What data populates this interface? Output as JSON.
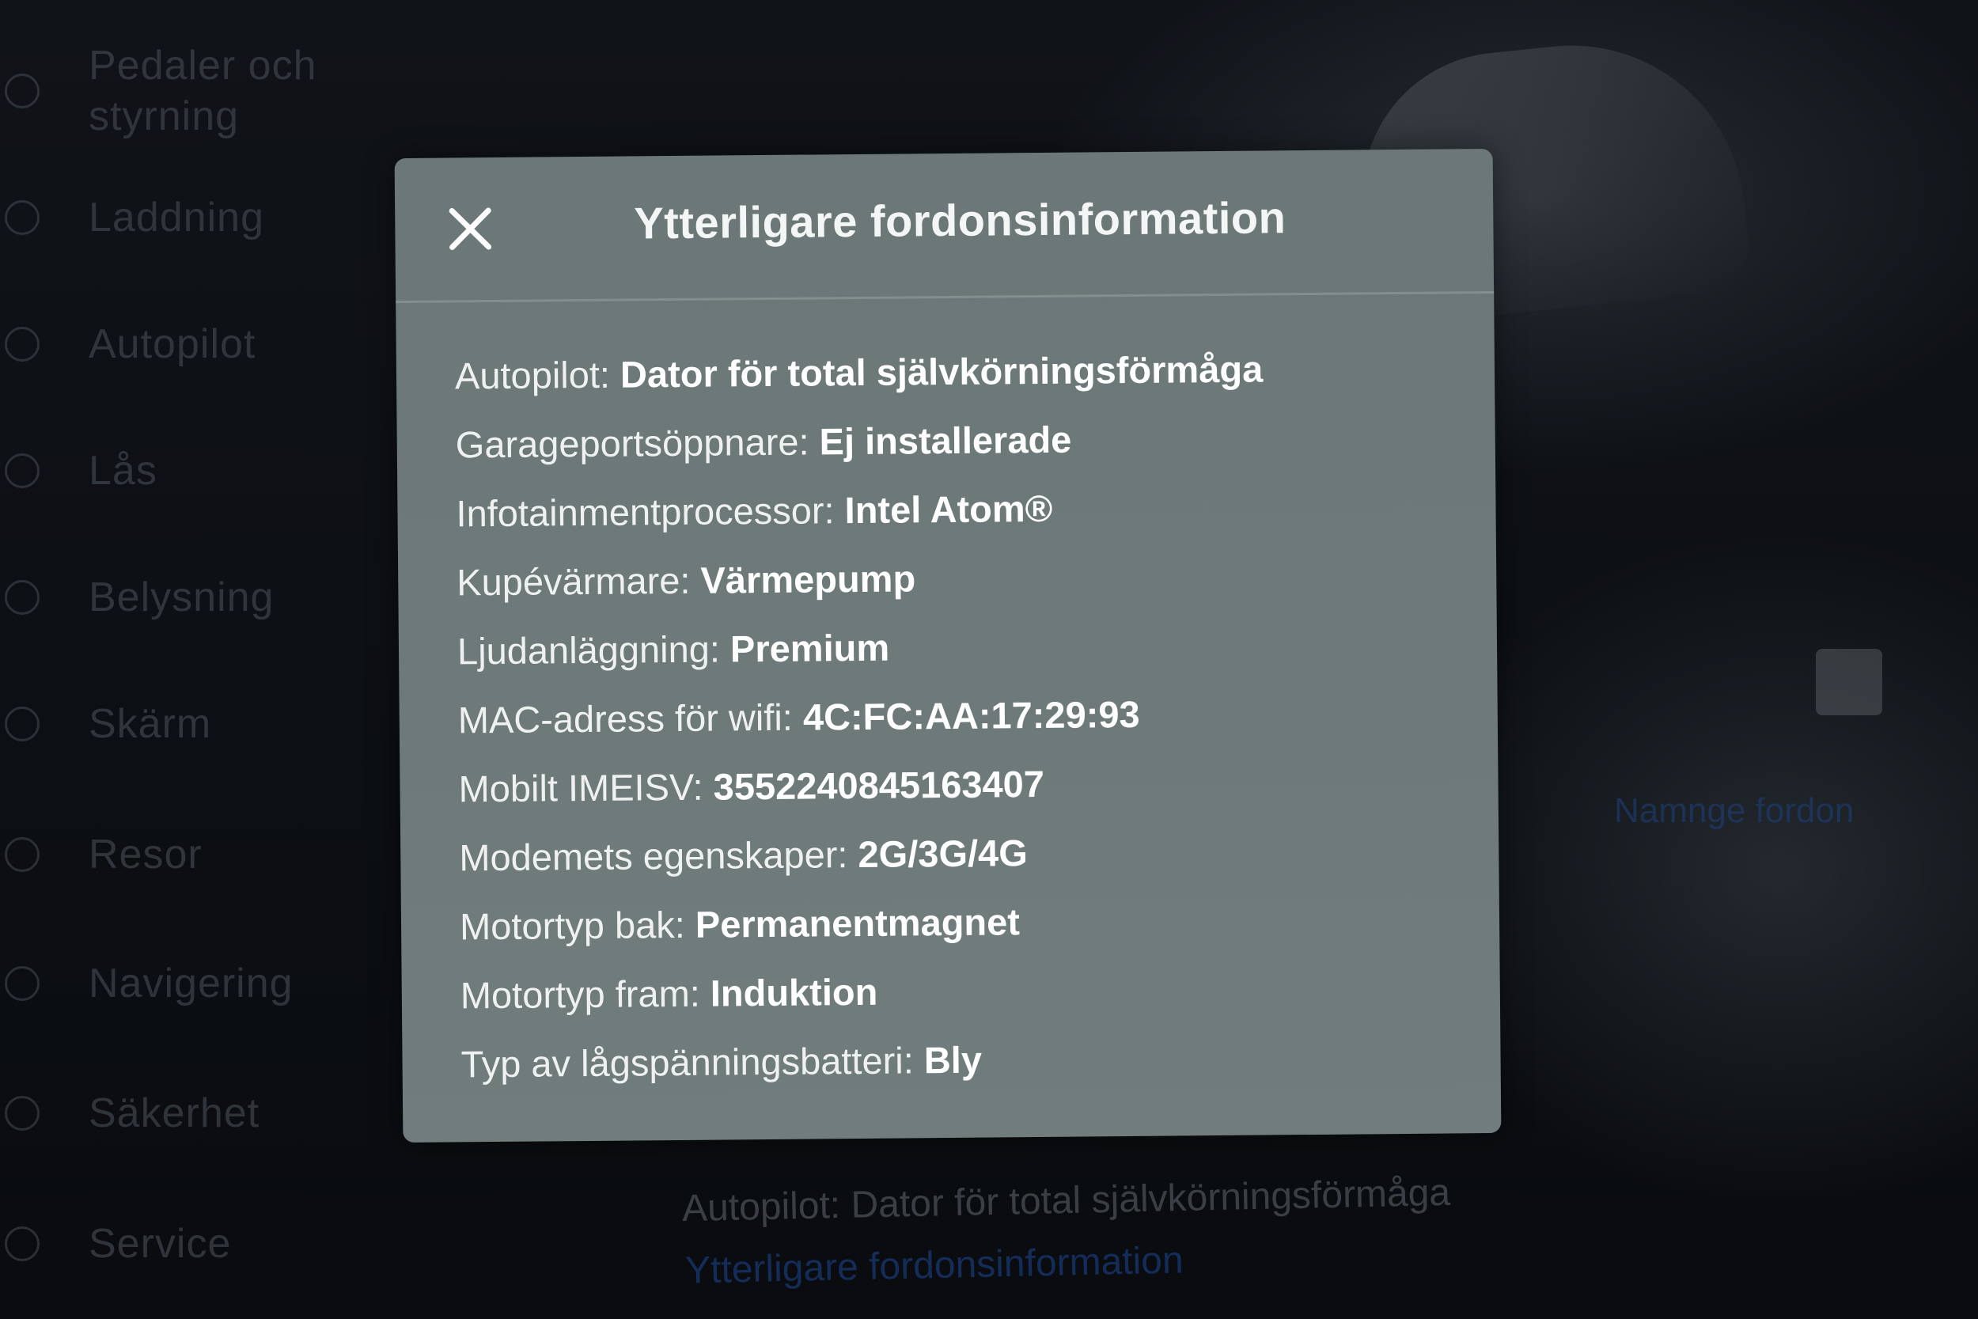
{
  "sidebar": {
    "items": [
      {
        "label": "Pedaler och\nstyrning",
        "icon": "car-icon"
      },
      {
        "label": "Laddning",
        "icon": "bolt-icon"
      },
      {
        "label": "Autopilot",
        "icon": "steering-wheel-icon"
      },
      {
        "label": "Lås",
        "icon": "lock-icon"
      },
      {
        "label": "Belysning",
        "icon": "light-icon"
      },
      {
        "label": "Skärm",
        "icon": "display-icon"
      },
      {
        "label": "Resor",
        "icon": "trips-icon"
      },
      {
        "label": "Navigering",
        "icon": "navigation-icon"
      },
      {
        "label": "Säkerhet",
        "icon": "shield-icon"
      },
      {
        "label": "Service",
        "icon": "wrench-icon"
      }
    ]
  },
  "background": {
    "autopilot_text": "Autopilot: Dator för total självkörningsförmåga",
    "more_info_link": "Ytterligare fordonsinformation",
    "name_vehicle_link": "Namnge fordon"
  },
  "modal": {
    "title": "Ytterligare fordonsinformation",
    "close_icon": "close-icon",
    "rows": [
      {
        "key": "Autopilot:",
        "value": "Dator för total självkörningsförmåga"
      },
      {
        "key": "Garageportsöppnare:",
        "value": "Ej installerade"
      },
      {
        "key": "Infotainmentprocessor:",
        "value": "Intel Atom®"
      },
      {
        "key": "Kupévärmare:",
        "value": "Värmepump"
      },
      {
        "key": "Ljudanläggning:",
        "value": "Premium"
      },
      {
        "key": "MAC-adress för wifi:",
        "value": "4C:FC:AA:17:29:93"
      },
      {
        "key": "Mobilt IMEISV:",
        "value": "3552240845163407"
      },
      {
        "key": "Modemets egenskaper:",
        "value": "2G/3G/4G"
      },
      {
        "key": "Motortyp bak:",
        "value": "Permanentmagnet"
      },
      {
        "key": "Motortyp fram:",
        "value": "Induktion"
      },
      {
        "key": "Typ av lågspänningsbatteri:",
        "value": "Bly"
      }
    ]
  },
  "colors": {
    "modal_bg": "#6e7a7a",
    "text": "#ffffff",
    "screen_bg": "#0c0f13"
  }
}
